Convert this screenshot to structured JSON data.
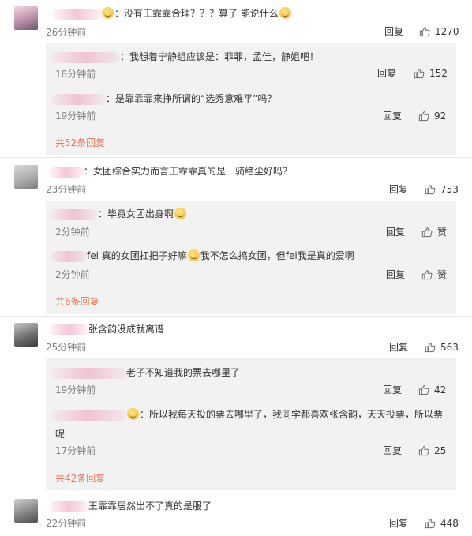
{
  "comments": [
    {
      "text": "：没有王霏霏合理？？？算了 能说什么",
      "time": "26分钟前",
      "reply": "回复",
      "likes": "1270",
      "replies": [
        {
          "text": "：我想着宁静组应该是：菲菲，孟佳，静姐吧！",
          "time": "18分钟前",
          "reply": "回复",
          "likes": "152"
        },
        {
          "text": "：是靠霏霏来挣所谓的“选秀意难平”吗？",
          "time": "19分钟前",
          "reply": "回复",
          "likes": "92"
        }
      ],
      "more": "共52条回复"
    },
    {
      "text": "：女团综合实力而言王霏霏真的是一骑绝尘好吗？",
      "time": "23分钟前",
      "reply": "回复",
      "likes": "753",
      "replies": [
        {
          "text": "：毕竟女团出身啊",
          "time": "2分钟前",
          "reply": "回复",
          "likes": "赞"
        },
        {
          "text_a": "fei 真的女团扛把子好嘛",
          "text_b": "我不怎么搞女团，但fei我是真的爱啊",
          "time": "2分钟前",
          "reply": "回复",
          "likes": "赞"
        }
      ],
      "more": "共6条回复"
    },
    {
      "text": "张含韵没成就离谱",
      "time": "25分钟前",
      "reply": "回复",
      "likes": "563",
      "replies": [
        {
          "text": "老子不知道我的票去哪里了",
          "time": "19分钟前",
          "reply": "回复",
          "likes": "42"
        },
        {
          "text_line1": "：所以我每天投的票去哪里了，我同学都喜欢张含韵，天天投票，所以票",
          "text_line2": "呢",
          "time": "17分钟前",
          "reply": "回复",
          "likes": "25"
        }
      ],
      "more": "共42条回复"
    },
    {
      "text": "王霏霏居然出不了真的是服了",
      "time": "22分钟前",
      "reply": "回复",
      "likes": "448"
    }
  ],
  "colors": {
    "accent": "#eb7350",
    "sub_bg": "#f2f2f2",
    "muted": "#808080"
  },
  "icons": [
    "thumb-up-icon",
    "emoji-icon"
  ]
}
